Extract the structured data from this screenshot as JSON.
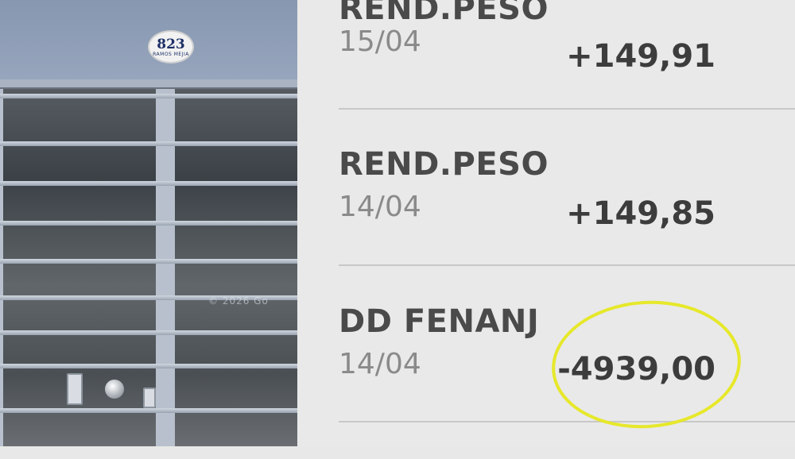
{
  "photo": {
    "house_number": "823",
    "house_number_subtext": "RAMOS MEJIA",
    "watermark": "© 2026 Go"
  },
  "transactions": [
    {
      "description": "REND.PESO",
      "date": "15/04",
      "amount": "+149,91"
    },
    {
      "description": "REND.PESO",
      "date": "14/04",
      "amount": "+149,85"
    },
    {
      "description": "DD FENANJ",
      "date": "14/04",
      "amount": "-4939,00",
      "highlighted": true
    }
  ],
  "colors": {
    "highlight": "#e6e82a",
    "description_text": "#4a4a4a",
    "date_text": "#8a8a8a",
    "amount_text": "#3c3c3c"
  }
}
